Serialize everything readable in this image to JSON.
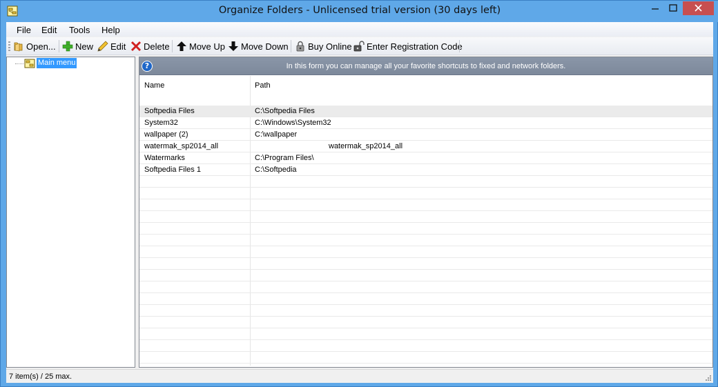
{
  "window": {
    "title": "Organize Folders - Unlicensed trial version (30 days left)",
    "accent": "#5fa8e8",
    "close_color": "#c74f50"
  },
  "menu": [
    "File",
    "Edit",
    "Tools",
    "Help"
  ],
  "toolbar": {
    "open": "Open...",
    "new": "New",
    "edit": "Edit",
    "delete": "Delete",
    "move_up": "Move Up",
    "move_down": "Move Down",
    "buy_online": "Buy Online",
    "register": "Enter Registration Code"
  },
  "tree": {
    "root_label": "Main menu"
  },
  "banner": {
    "text": "In this form you can manage all your favorite shortcuts to fixed and network folders."
  },
  "grid": {
    "columns": [
      "Name",
      "Path"
    ],
    "rows": [
      {
        "name": "Softpedia Files",
        "path": "C:\\Softpedia Files"
      },
      {
        "name": "System32",
        "path": "C:\\Windows\\System32"
      },
      {
        "name": "wallpaper (2)",
        "path": "C:\\wallpaper"
      },
      {
        "name": "watermak_sp2014_all",
        "path": "watermak_sp2014_all"
      },
      {
        "name": "Watermarks",
        "path": "C:\\Program Files\\"
      },
      {
        "name": "Softpedia Files 1",
        "path": "C:\\Softpedia"
      }
    ]
  },
  "status": {
    "text": "7 item(s) / 25 max."
  }
}
